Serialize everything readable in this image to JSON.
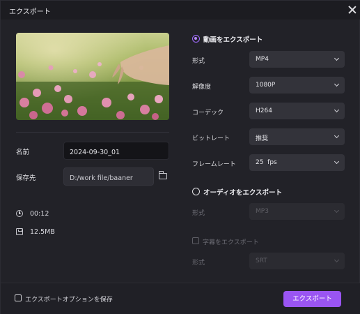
{
  "window": {
    "title": "エクスポート"
  },
  "left": {
    "name_label": "名前",
    "name_value": "2024-09-30_01",
    "save_label": "保存先",
    "save_path": "D:/work file/baaner",
    "duration": "00:12",
    "size": "12.5MB"
  },
  "video": {
    "section_label": "動画をエクスポート",
    "format_label": "形式",
    "format_value": "MP4",
    "resolution_label": "解像度",
    "resolution_value": "1080P",
    "codec_label": "コーデック",
    "codec_value": "H264",
    "bitrate_label": "ビットレート",
    "bitrate_value": "推奨",
    "framerate_label": "フレームレート",
    "framerate_value": "25  fps"
  },
  "audio": {
    "section_label": "オーディオをエクスポート",
    "format_label": "形式",
    "format_value": "MP3"
  },
  "subtitle": {
    "checkbox_label": "字幕をエクスポート",
    "format_label": "形式",
    "format_value": "SRT"
  },
  "footer": {
    "save_options_label": "エクスポートオプションを保存",
    "export_button": "エクスポート"
  },
  "colors": {
    "accent": "#9a55f2",
    "background": "#222228",
    "field": "#33333a"
  },
  "icons": [
    "close-icon",
    "folder-icon",
    "clock-icon",
    "disk-icon",
    "chevron-down-icon"
  ]
}
